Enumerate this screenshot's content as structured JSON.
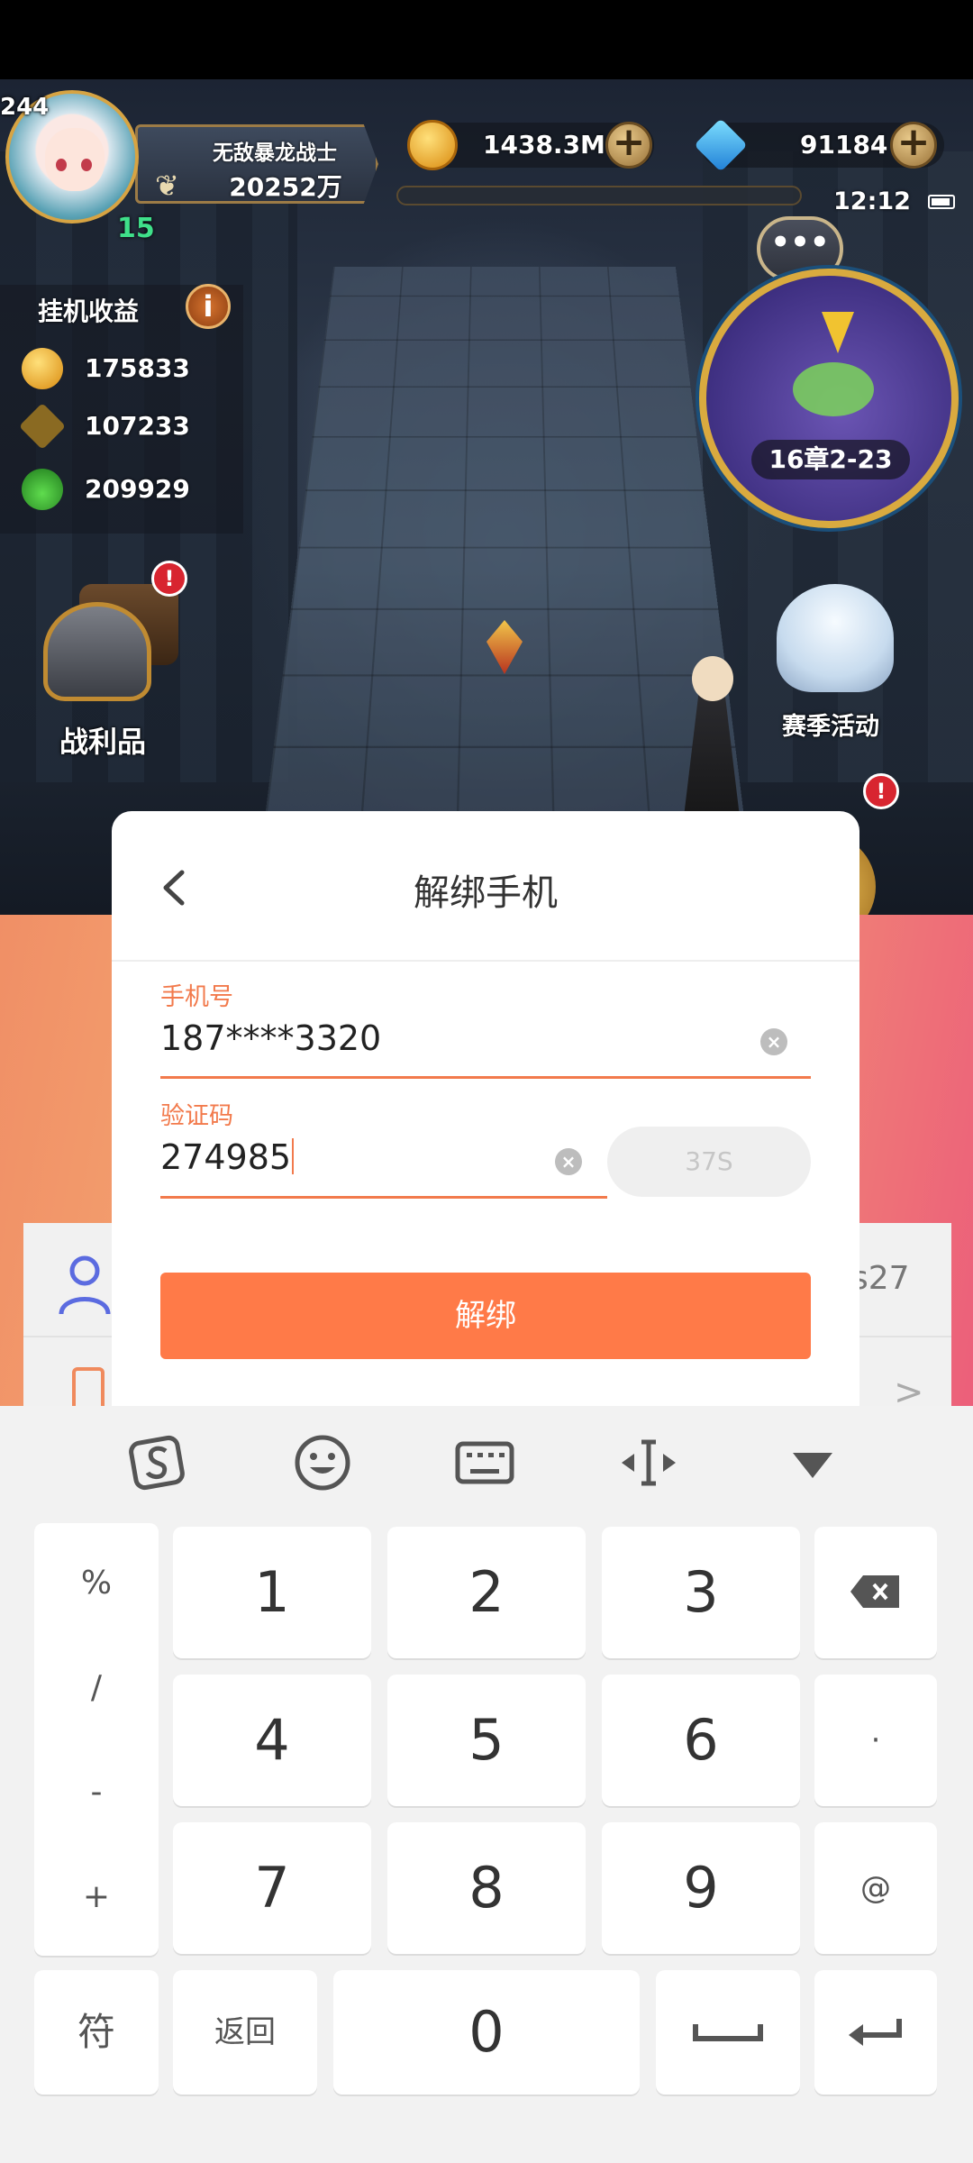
{
  "game": {
    "player": {
      "level": "244",
      "vip": "15",
      "name": "无敌暴龙战士",
      "power": "20252万"
    },
    "resources": {
      "gold": "1438.3M",
      "diamonds": "91184",
      "plus_label": "+"
    },
    "clock": "12:12",
    "idle_income": {
      "title": "挂机收益",
      "info": "i",
      "gold": "175833",
      "exp": "107233",
      "potion": "209929"
    },
    "chat_icon": "•••",
    "minimap": {
      "chapter": "16章2-23"
    },
    "loot": {
      "label": "战利品",
      "alert": "!"
    },
    "season": {
      "label": "赛季活动",
      "alert": "!"
    }
  },
  "app_background": {
    "right_text": "s27",
    "chevron": ">"
  },
  "modal": {
    "title": "解绑手机",
    "phone": {
      "label": "手机号",
      "value": "187****3320"
    },
    "code": {
      "label": "验证码",
      "value": "274985",
      "countdown": "37S"
    },
    "submit_label": "解绑",
    "clear_icon": "×"
  },
  "keyboard": {
    "side_symbols": [
      "%",
      "/",
      "-",
      "+"
    ],
    "row1": [
      "1",
      "2",
      "3"
    ],
    "row2": [
      "4",
      "5",
      "6"
    ],
    "row3": [
      "7",
      "8",
      "9"
    ],
    "dot": "·",
    "at": "@",
    "symbols_label": "符",
    "return_label": "返回",
    "zero": "0"
  },
  "colors": {
    "accent": "#ff7a48",
    "label": "#f27a4c",
    "keyboard_bg": "#f2f2f2"
  }
}
